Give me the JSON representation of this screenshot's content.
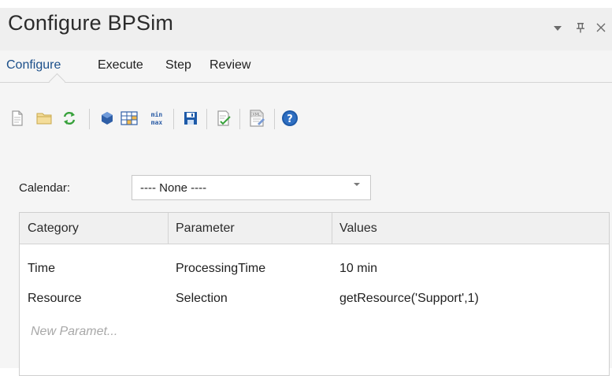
{
  "window": {
    "title": "Configure BPSim",
    "controls": {
      "dropdown": "▾",
      "pin": "ᵖ",
      "close": "×"
    }
  },
  "tabs": [
    {
      "label": "Configure",
      "active": true
    },
    {
      "label": "Execute",
      "active": false
    },
    {
      "label": "Step",
      "active": false
    },
    {
      "label": "Review",
      "active": false
    }
  ],
  "toolbar": {
    "icons": [
      "new-document-icon",
      "open-folder-icon",
      "refresh-icon",
      "element-icon",
      "grid-table-icon",
      "min-max-icon",
      "save-icon",
      "validate-icon",
      "export-xml-icon",
      "help-icon"
    ],
    "minmax_top": "min",
    "minmax_bottom": "max",
    "xml_label": "XML"
  },
  "calendar": {
    "label": "Calendar:",
    "value": "---- None ----"
  },
  "grid": {
    "columns": [
      "Category",
      "Parameter",
      "Values"
    ],
    "rows": [
      {
        "category": "Time",
        "parameter": "ProcessingTime",
        "value": "10 min"
      },
      {
        "category": "Resource",
        "parameter": "Selection",
        "value": "getResource('Support',1)"
      }
    ],
    "new_placeholder": "New Paramet..."
  },
  "colors": {
    "active_tab": "#1b4f8a",
    "accent_blue": "#1e5aa8",
    "refresh_green": "#37a13b",
    "folder_yellow": "#e9c46a"
  }
}
